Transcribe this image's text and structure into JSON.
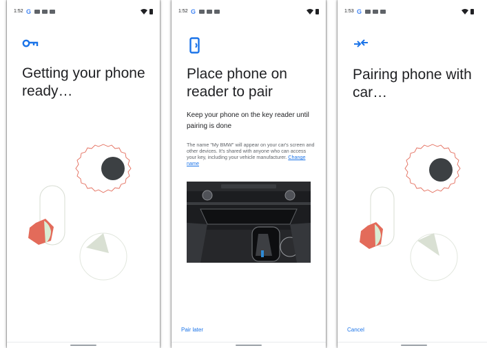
{
  "screen1": {
    "status_time": "1:52",
    "title": "Getting your phone ready…"
  },
  "screen2": {
    "status_time": "1:52",
    "title": "Place phone on reader to pair",
    "instruction": "Keep your phone on the key reader until pairing is done",
    "note": "The name \"My BMW\" will appear on your car's screen and other devices. It's shared with anyone who can access your key, including your vehicle manufacturer.",
    "change_name_link": "Change name",
    "pair_later_button": "Pair later"
  },
  "screen3": {
    "status_time": "1:53",
    "title": "Pairing phone with car…",
    "cancel_button": "Cancel"
  },
  "status_google_letter": "G",
  "icons": {
    "screen1": "key-icon",
    "screen2": "phone-nfc-icon",
    "screen3": "pairing-arrows-icon"
  },
  "colors": {
    "accent": "#1a73e8",
    "coral": "#e36b5a",
    "dark_circle": "#3c4043",
    "pale_green": "#d9ecd3"
  }
}
